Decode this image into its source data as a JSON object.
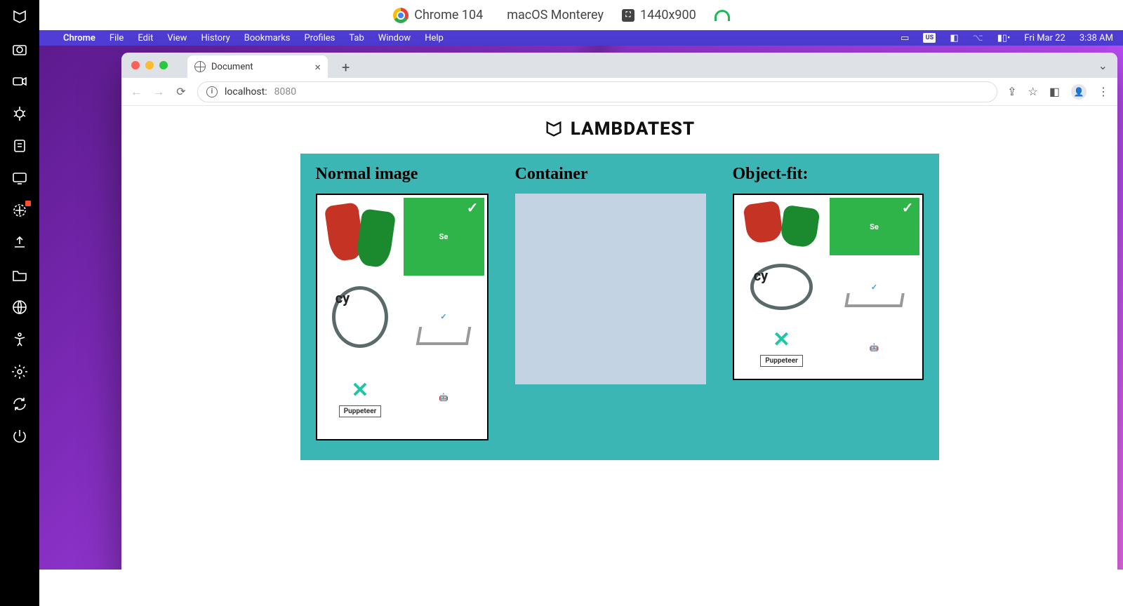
{
  "topbar": {
    "browser": "Chrome 104",
    "os": "macOS Monterey",
    "dims": "1440x900"
  },
  "menubar": {
    "app": "Chrome",
    "items": [
      "File",
      "Edit",
      "View",
      "History",
      "Bookmarks",
      "Profiles",
      "Tab",
      "Window",
      "Help"
    ],
    "date": "Fri Mar 22",
    "time": "3:38 AM",
    "input": "US"
  },
  "chrome": {
    "tab_title": "Document",
    "url_host": "localhost:",
    "url_port": "8080"
  },
  "page": {
    "brand": "LAMBDATEST",
    "headings": {
      "normal": "Normal image",
      "container": "Container",
      "objectfit": "Object-fit:"
    },
    "logo_labels": {
      "selenium": "Se",
      "cypress": "cy",
      "puppeteer": "Puppeteer"
    }
  }
}
